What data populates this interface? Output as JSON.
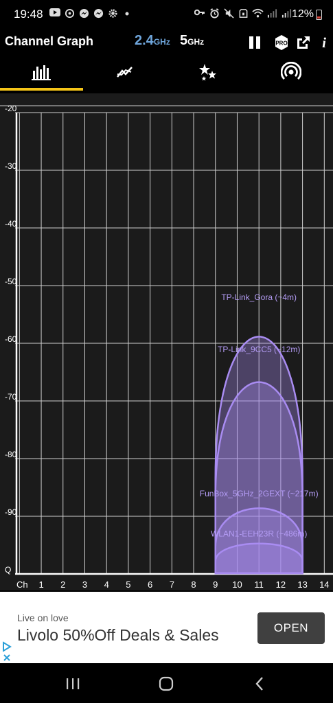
{
  "status_bar": {
    "time": "19:48",
    "battery_percent": "12%",
    "left_icons": [
      "youtube-icon",
      "sync-icon",
      "messenger-icon",
      "messenger-icon",
      "settings-icon",
      "dot-icon"
    ],
    "right_icons": [
      "key-icon",
      "alarm-icon",
      "mute-icon",
      "nfc-icon",
      "wifi-icon",
      "signal-icon",
      "signal-icon"
    ]
  },
  "header": {
    "title": "Channel Graph",
    "band_24": "2.4",
    "band_24_unit": "GHz",
    "band_5": "5",
    "band_5_unit": "GHz",
    "pro_label": "PRO",
    "info_label": "i",
    "colors": {
      "band_active": "#6fa6dc",
      "tab_indicator": "#f5c518"
    }
  },
  "tabs": [
    {
      "icon": "bar-chart-icon",
      "active": true
    },
    {
      "icon": "time-graph-icon",
      "active": false
    },
    {
      "icon": "stars-icon",
      "active": false
    },
    {
      "icon": "access-point-icon",
      "active": false
    }
  ],
  "chart_data": {
    "type": "area",
    "y_tick_labels": [
      "-20",
      "-30",
      "-40",
      "-50",
      "-60",
      "-70",
      "-80",
      "-90",
      "Q"
    ],
    "y_ticks": [
      -20,
      -30,
      -40,
      -50,
      -60,
      -70,
      -80,
      -90,
      -100
    ],
    "ylim": [
      -100,
      -20
    ],
    "x_label": "Ch",
    "x_ticks": [
      "1",
      "2",
      "3",
      "4",
      "5",
      "6",
      "7",
      "8",
      "9",
      "10",
      "11",
      "12",
      "13",
      "14"
    ],
    "xlim": [
      -0.2,
      14.4
    ],
    "grid": true,
    "fill_color": "#a98cf2",
    "label_color": "#b49cf5",
    "series": [
      {
        "name": "TP-Link_Gora (~4m)",
        "center": 11,
        "width": 4,
        "signal": -53
      },
      {
        "name": "TP-Link_9CC5 (~12m)",
        "center": 11,
        "width": 4,
        "signal": -62
      },
      {
        "name": "FunBox_5GHz_2GEXT (~217m)",
        "center": 11,
        "width": 4,
        "signal": -87
      },
      {
        "name": "WLAN1-EEH23R (~486m)",
        "center": 11,
        "width": 4,
        "signal": -94
      }
    ]
  },
  "ad": {
    "subtitle": "Live on love",
    "title": "Livolo 50%Off Deals & Sales",
    "button_label": "OPEN"
  }
}
